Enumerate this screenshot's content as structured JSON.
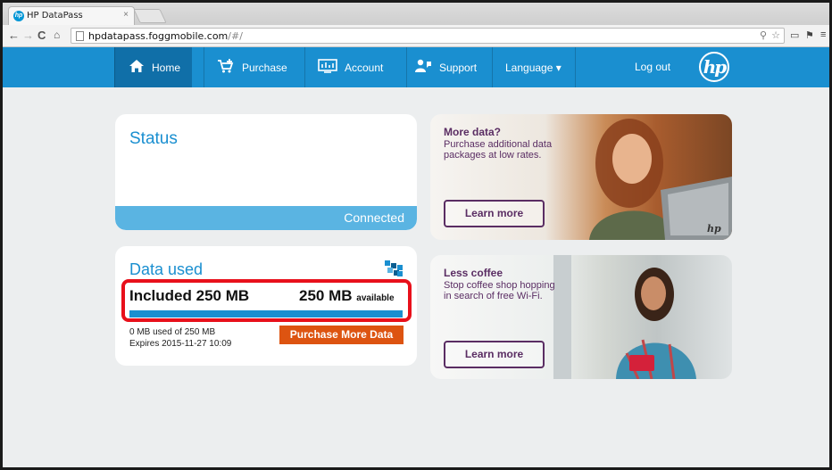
{
  "browser": {
    "tab_title": "HP DataPass",
    "tab_close": "×",
    "favicon_text": "hp",
    "url_host": "hpdatapass.foggmobile.com",
    "url_path": "/#/"
  },
  "nav": {
    "home": "Home",
    "purchase": "Purchase",
    "account": "Account",
    "support": "Support",
    "language": "Language ▾",
    "logout": "Log out",
    "logo": "hp"
  },
  "status": {
    "title": "Status",
    "state": "Connected"
  },
  "data_used": {
    "title": "Data used",
    "included": "Included 250 MB",
    "available_amount": "250 MB",
    "available_label": "available",
    "used_fraction": 0.0,
    "used_text": "0 MB used of 250 MB",
    "expires_text": "Expires 2015-11-27 10:09",
    "purchase_button": "Purchase More Data"
  },
  "promos": [
    {
      "title": "More data?",
      "description": "Purchase additional data packages at low rates.",
      "button": "Learn more",
      "logo": "hp"
    },
    {
      "title": "Less coffee",
      "description": "Stop coffee shop hopping in search of free Wi-Fi.",
      "button": "Learn more"
    }
  ],
  "colors": {
    "header": "#1a8fd0",
    "accent_purple": "#5a2d63",
    "purchase_orange": "#dd5411",
    "highlight_red": "#e8101b"
  }
}
